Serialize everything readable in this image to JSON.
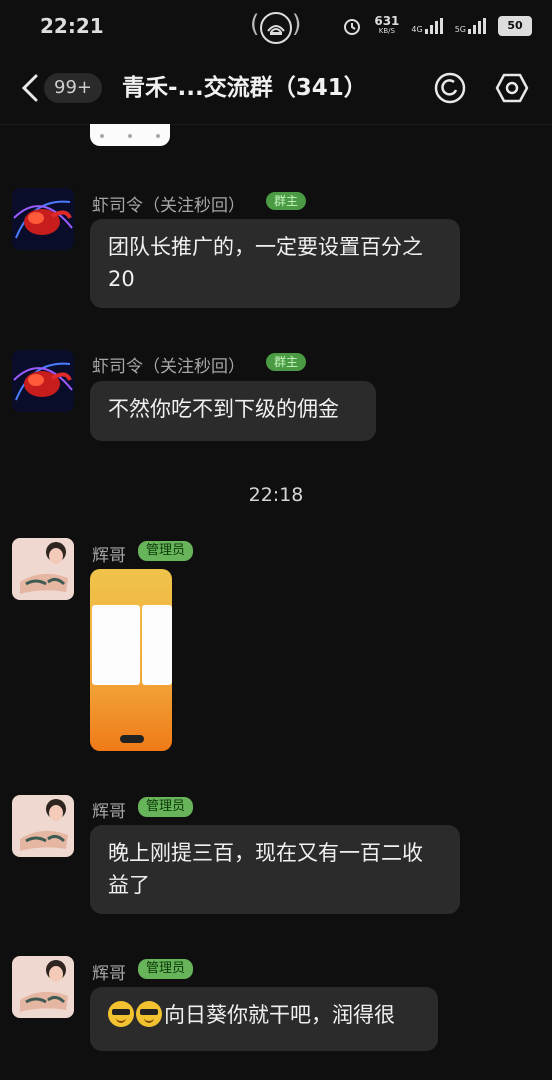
{
  "status_bar": {
    "time": "22:21",
    "net_speed": "631",
    "net_unit": "KB/S",
    "sig1": "4G",
    "sig2": "5G",
    "battery": "50"
  },
  "header": {
    "unread_badge": "99+",
    "title": "青禾-...交流群（341）"
  },
  "messages": [
    {
      "sender": "虾司令（关注秒回）",
      "role": "群主",
      "text": "团队长推广的，一定要设置百分之20"
    },
    {
      "sender": "虾司令（关注秒回）",
      "role": "群主",
      "text": "不然你吃不到下级的佣金"
    },
    {
      "timestamp": "22:18"
    },
    {
      "sender": "辉哥",
      "role": "管理员",
      "type": "image"
    },
    {
      "sender": "辉哥",
      "role": "管理员",
      "text": "晚上刚提三百，现在又有一百二收益了"
    },
    {
      "sender": "辉哥",
      "role": "管理员",
      "text": "向日葵你就干吧，润得很",
      "emoji_count": 2
    }
  ],
  "colors": {
    "background": "#0f0f10",
    "bubble": "#2b2b2c",
    "role_badge": "#68b45a"
  }
}
